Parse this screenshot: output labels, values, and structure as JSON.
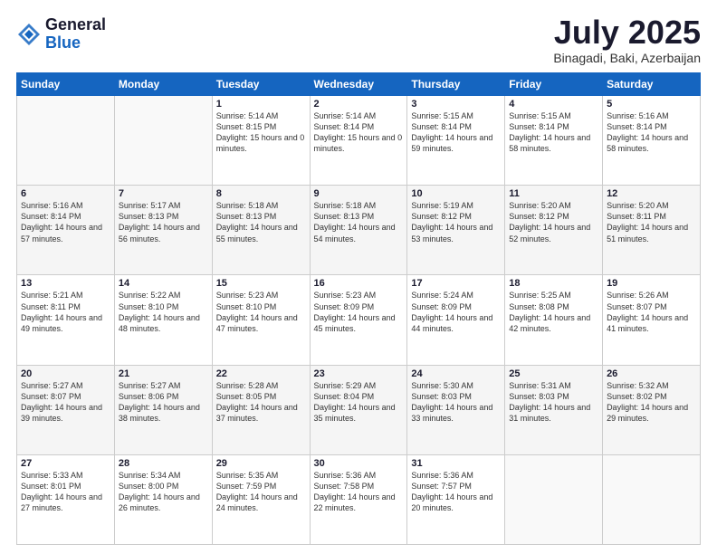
{
  "header": {
    "logo_general": "General",
    "logo_blue": "Blue",
    "title": "July 2025",
    "subtitle": "Binagadi, Baki, Azerbaijan"
  },
  "days_of_week": [
    "Sunday",
    "Monday",
    "Tuesday",
    "Wednesday",
    "Thursday",
    "Friday",
    "Saturday"
  ],
  "weeks": [
    [
      {
        "num": "",
        "sunrise": "",
        "sunset": "",
        "daylight": ""
      },
      {
        "num": "",
        "sunrise": "",
        "sunset": "",
        "daylight": ""
      },
      {
        "num": "1",
        "sunrise": "Sunrise: 5:14 AM",
        "sunset": "Sunset: 8:15 PM",
        "daylight": "Daylight: 15 hours and 0 minutes."
      },
      {
        "num": "2",
        "sunrise": "Sunrise: 5:14 AM",
        "sunset": "Sunset: 8:14 PM",
        "daylight": "Daylight: 15 hours and 0 minutes."
      },
      {
        "num": "3",
        "sunrise": "Sunrise: 5:15 AM",
        "sunset": "Sunset: 8:14 PM",
        "daylight": "Daylight: 14 hours and 59 minutes."
      },
      {
        "num": "4",
        "sunrise": "Sunrise: 5:15 AM",
        "sunset": "Sunset: 8:14 PM",
        "daylight": "Daylight: 14 hours and 58 minutes."
      },
      {
        "num": "5",
        "sunrise": "Sunrise: 5:16 AM",
        "sunset": "Sunset: 8:14 PM",
        "daylight": "Daylight: 14 hours and 58 minutes."
      }
    ],
    [
      {
        "num": "6",
        "sunrise": "Sunrise: 5:16 AM",
        "sunset": "Sunset: 8:14 PM",
        "daylight": "Daylight: 14 hours and 57 minutes."
      },
      {
        "num": "7",
        "sunrise": "Sunrise: 5:17 AM",
        "sunset": "Sunset: 8:13 PM",
        "daylight": "Daylight: 14 hours and 56 minutes."
      },
      {
        "num": "8",
        "sunrise": "Sunrise: 5:18 AM",
        "sunset": "Sunset: 8:13 PM",
        "daylight": "Daylight: 14 hours and 55 minutes."
      },
      {
        "num": "9",
        "sunrise": "Sunrise: 5:18 AM",
        "sunset": "Sunset: 8:13 PM",
        "daylight": "Daylight: 14 hours and 54 minutes."
      },
      {
        "num": "10",
        "sunrise": "Sunrise: 5:19 AM",
        "sunset": "Sunset: 8:12 PM",
        "daylight": "Daylight: 14 hours and 53 minutes."
      },
      {
        "num": "11",
        "sunrise": "Sunrise: 5:20 AM",
        "sunset": "Sunset: 8:12 PM",
        "daylight": "Daylight: 14 hours and 52 minutes."
      },
      {
        "num": "12",
        "sunrise": "Sunrise: 5:20 AM",
        "sunset": "Sunset: 8:11 PM",
        "daylight": "Daylight: 14 hours and 51 minutes."
      }
    ],
    [
      {
        "num": "13",
        "sunrise": "Sunrise: 5:21 AM",
        "sunset": "Sunset: 8:11 PM",
        "daylight": "Daylight: 14 hours and 49 minutes."
      },
      {
        "num": "14",
        "sunrise": "Sunrise: 5:22 AM",
        "sunset": "Sunset: 8:10 PM",
        "daylight": "Daylight: 14 hours and 48 minutes."
      },
      {
        "num": "15",
        "sunrise": "Sunrise: 5:23 AM",
        "sunset": "Sunset: 8:10 PM",
        "daylight": "Daylight: 14 hours and 47 minutes."
      },
      {
        "num": "16",
        "sunrise": "Sunrise: 5:23 AM",
        "sunset": "Sunset: 8:09 PM",
        "daylight": "Daylight: 14 hours and 45 minutes."
      },
      {
        "num": "17",
        "sunrise": "Sunrise: 5:24 AM",
        "sunset": "Sunset: 8:09 PM",
        "daylight": "Daylight: 14 hours and 44 minutes."
      },
      {
        "num": "18",
        "sunrise": "Sunrise: 5:25 AM",
        "sunset": "Sunset: 8:08 PM",
        "daylight": "Daylight: 14 hours and 42 minutes."
      },
      {
        "num": "19",
        "sunrise": "Sunrise: 5:26 AM",
        "sunset": "Sunset: 8:07 PM",
        "daylight": "Daylight: 14 hours and 41 minutes."
      }
    ],
    [
      {
        "num": "20",
        "sunrise": "Sunrise: 5:27 AM",
        "sunset": "Sunset: 8:07 PM",
        "daylight": "Daylight: 14 hours and 39 minutes."
      },
      {
        "num": "21",
        "sunrise": "Sunrise: 5:27 AM",
        "sunset": "Sunset: 8:06 PM",
        "daylight": "Daylight: 14 hours and 38 minutes."
      },
      {
        "num": "22",
        "sunrise": "Sunrise: 5:28 AM",
        "sunset": "Sunset: 8:05 PM",
        "daylight": "Daylight: 14 hours and 37 minutes."
      },
      {
        "num": "23",
        "sunrise": "Sunrise: 5:29 AM",
        "sunset": "Sunset: 8:04 PM",
        "daylight": "Daylight: 14 hours and 35 minutes."
      },
      {
        "num": "24",
        "sunrise": "Sunrise: 5:30 AM",
        "sunset": "Sunset: 8:03 PM",
        "daylight": "Daylight: 14 hours and 33 minutes."
      },
      {
        "num": "25",
        "sunrise": "Sunrise: 5:31 AM",
        "sunset": "Sunset: 8:03 PM",
        "daylight": "Daylight: 14 hours and 31 minutes."
      },
      {
        "num": "26",
        "sunrise": "Sunrise: 5:32 AM",
        "sunset": "Sunset: 8:02 PM",
        "daylight": "Daylight: 14 hours and 29 minutes."
      }
    ],
    [
      {
        "num": "27",
        "sunrise": "Sunrise: 5:33 AM",
        "sunset": "Sunset: 8:01 PM",
        "daylight": "Daylight: 14 hours and 27 minutes."
      },
      {
        "num": "28",
        "sunrise": "Sunrise: 5:34 AM",
        "sunset": "Sunset: 8:00 PM",
        "daylight": "Daylight: 14 hours and 26 minutes."
      },
      {
        "num": "29",
        "sunrise": "Sunrise: 5:35 AM",
        "sunset": "Sunset: 7:59 PM",
        "daylight": "Daylight: 14 hours and 24 minutes."
      },
      {
        "num": "30",
        "sunrise": "Sunrise: 5:36 AM",
        "sunset": "Sunset: 7:58 PM",
        "daylight": "Daylight: 14 hours and 22 minutes."
      },
      {
        "num": "31",
        "sunrise": "Sunrise: 5:36 AM",
        "sunset": "Sunset: 7:57 PM",
        "daylight": "Daylight: 14 hours and 20 minutes."
      },
      {
        "num": "",
        "sunrise": "",
        "sunset": "",
        "daylight": ""
      },
      {
        "num": "",
        "sunrise": "",
        "sunset": "",
        "daylight": ""
      }
    ]
  ]
}
